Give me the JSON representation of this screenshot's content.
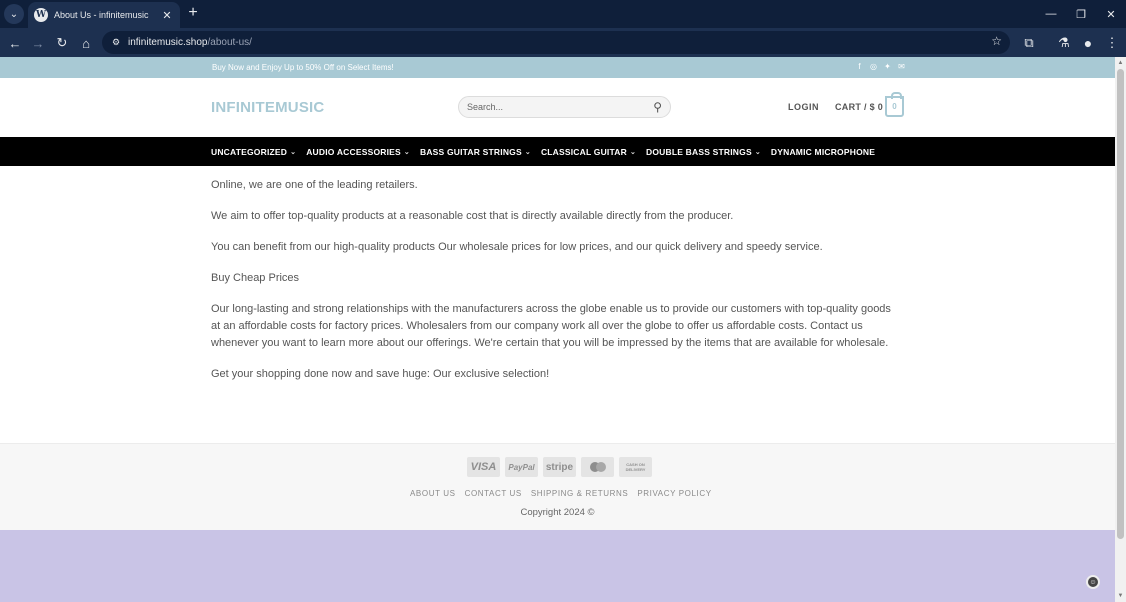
{
  "browser": {
    "tab_title": "About Us - infinitemusic",
    "url_host": "infinitemusic.shop",
    "url_path": "/about-us/"
  },
  "topbar": {
    "promo": "Buy Now and Enjoy Up to 50% Off on Select Items!",
    "socials": [
      "facebook-icon",
      "instagram-icon",
      "twitter-icon",
      "email-icon"
    ]
  },
  "header": {
    "logo": "INFINITEMUSIC",
    "search_placeholder": "Search...",
    "login": "LOGIN",
    "cart": "CART / $ 0",
    "cart_count": "0"
  },
  "nav": [
    {
      "label": "UNCATEGORIZED",
      "dropdown": true
    },
    {
      "label": "AUDIO ACCESSORIES",
      "dropdown": true
    },
    {
      "label": "BASS GUITAR STRINGS",
      "dropdown": true
    },
    {
      "label": "CLASSICAL GUITAR",
      "dropdown": true
    },
    {
      "label": "DOUBLE BASS STRINGS",
      "dropdown": true
    },
    {
      "label": "DYNAMIC MICROPHONE",
      "dropdown": false
    }
  ],
  "content": {
    "paragraphs": [
      "Online, we are one of the leading retailers.",
      "We aim to offer top-quality products at a reasonable cost that is directly available directly from the producer.",
      "You can benefit from our high-quality products Our wholesale prices for low prices, and our quick delivery and speedy service.",
      "Buy Cheap Prices",
      "Our long-lasting and strong relationships with the manufacturers across the globe enable us to provide our customers with top-quality goods at an affordable costs for factory prices. Wholesalers from our company work all over the globe to offer us affordable costs. Contact us whenever you want to learn more about our offerings. We're certain that you will be impressed by the items that are available for wholesale.",
      "Get your shopping done now and save huge: Our exclusive selection!"
    ]
  },
  "footer": {
    "payments": {
      "visa": "VISA",
      "paypal": "PayPal",
      "stripe": "stripe",
      "cod": "CASH ON DELIVERY"
    },
    "links": [
      "ABOUT US",
      "CONTACT US",
      "SHIPPING & RETURNS",
      "PRIVACY POLICY"
    ],
    "copyright": "Copyright 2024 ©"
  },
  "colors": {
    "accent": "#a8c9d4",
    "nav_bg": "#000000",
    "chrome_bg": "#0f1f3a",
    "bottom_bg": "#c9c4e6"
  }
}
